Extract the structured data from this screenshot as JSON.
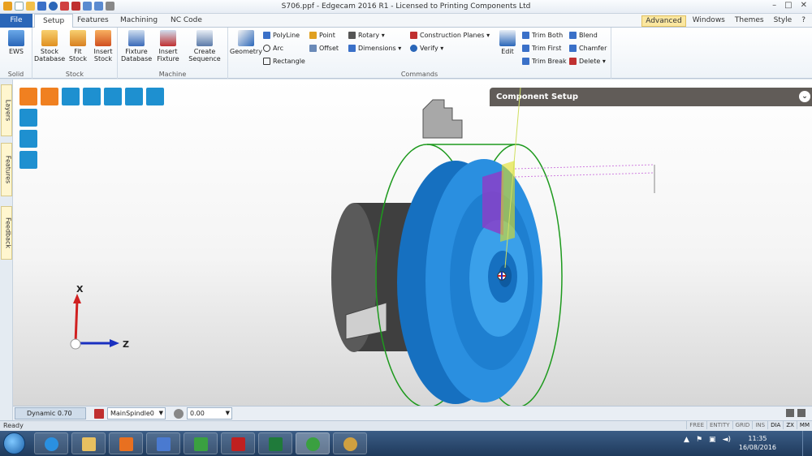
{
  "window": {
    "title": "S706.ppf - Edgecam 2016 R1  -  Licensed to Printing Components Ltd"
  },
  "tabs": {
    "file": "File",
    "setup": "Setup",
    "features": "Features",
    "machining": "Machining",
    "nc_code": "NC Code"
  },
  "right_menu": {
    "advanced": "Advanced",
    "windows": "Windows",
    "themes": "Themes",
    "style": "Style",
    "help": "?"
  },
  "ribbon": {
    "solid": {
      "label": "Solid",
      "ews": "EWS"
    },
    "stock": {
      "label": "Stock",
      "stock_database": "Stock Database",
      "fit_stock": "Fit Stock",
      "insert_stock": "Insert Stock"
    },
    "machine": {
      "label": "Machine",
      "fixture_database": "Fixture Database",
      "insert_fixture": "Insert Fixture",
      "create_sequence": "Create Sequence"
    },
    "commands": {
      "label": "Commands",
      "geometry": "Geometry",
      "polyline": "PolyLine",
      "arc": "Arc",
      "rectangle": "Rectangle",
      "point": "Point",
      "offset": "Offset",
      "rotary": "Rotary",
      "dimensions": "Dimensions",
      "construction_planes": "Construction Planes",
      "verify": "Verify",
      "edit": "Edit",
      "trim_both": "Trim Both",
      "trim_first": "Trim First",
      "trim_break": "Trim Break",
      "blend": "Blend",
      "chamfer": "Chamfer",
      "delete": "Delete"
    }
  },
  "side_tabs": {
    "layers": "Layers",
    "features": "Features",
    "feedback": "Feedback"
  },
  "viewport": {
    "component_setup": "Component Setup",
    "axis_x": "X",
    "axis_z": "Z",
    "colors": {
      "part": "#2a8fe0",
      "bound": "#1e9a1e",
      "stock": "#555555",
      "toolpath": "#8a3fc9"
    }
  },
  "bottom_bar": {
    "dynamic": "Dynamic 0.70",
    "spindle": "MainSpindle0",
    "value": "0.00"
  },
  "status": {
    "ready": "Ready",
    "indicators": [
      "FREE",
      "ENTITY",
      "GRID",
      "INS",
      "DIA",
      "ZX",
      "MM"
    ]
  },
  "taskbar": {
    "time": "11:35",
    "date": "16/08/2016"
  }
}
